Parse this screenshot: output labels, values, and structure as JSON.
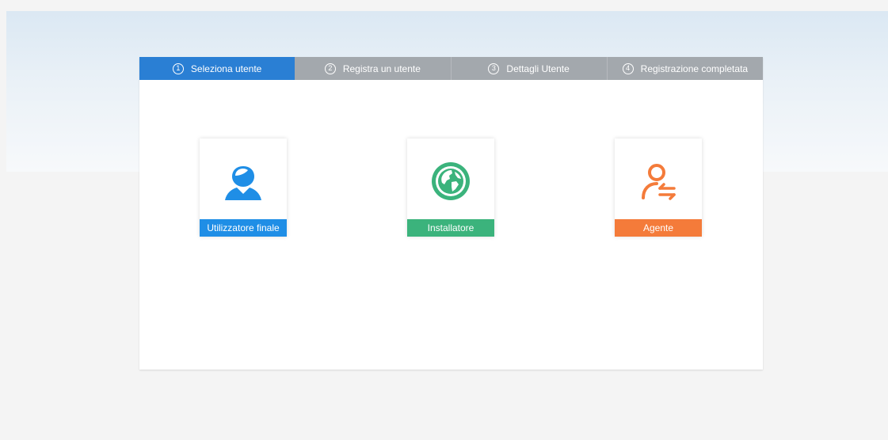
{
  "steps": [
    {
      "num": "1",
      "label": "Seleziona utente",
      "active": true
    },
    {
      "num": "2",
      "label": "Registra un utente",
      "active": false
    },
    {
      "num": "3",
      "label": "Dettagli Utente",
      "active": false
    },
    {
      "num": "4",
      "label": "Registrazione completata",
      "active": false
    }
  ],
  "cards": [
    {
      "label": "Utilizzatore finale",
      "icon": "user-icon",
      "color": "#1f8ee6"
    },
    {
      "label": "Installatore",
      "icon": "globe-icon",
      "color": "#3bb37c"
    },
    {
      "label": "Agente",
      "icon": "agent-transfer-icon",
      "color": "#f47b3a"
    }
  ]
}
